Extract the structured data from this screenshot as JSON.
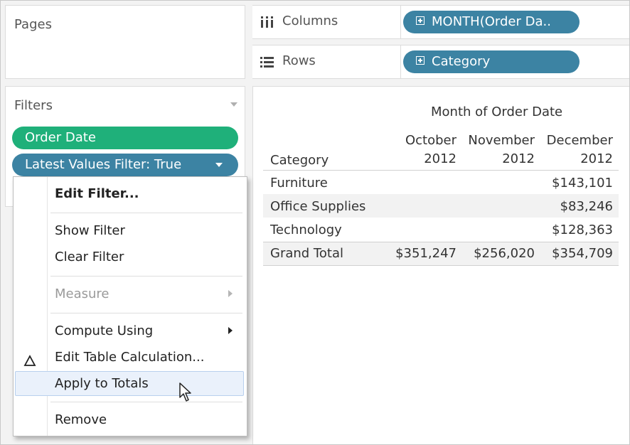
{
  "pages_card": {
    "title": "Pages"
  },
  "filters_card": {
    "title": "Filters",
    "pills": [
      {
        "label": "Order Date",
        "color": "#1fb07a"
      },
      {
        "label": "Latest Values Filter: True",
        "color": "#3c83a3"
      }
    ]
  },
  "shelves": {
    "columns": {
      "label": "Columns",
      "icon": "columns-icon",
      "pill": "MONTH(Order Da..",
      "pill_color": "#3c83a3"
    },
    "rows": {
      "label": "Rows",
      "icon": "rows-icon",
      "pill": "Category",
      "pill_color": "#3c83a3"
    }
  },
  "view": {
    "header_title": "Month of Order Date",
    "row_header": "Category",
    "columns": [
      {
        "month": "October",
        "year": "2012"
      },
      {
        "month": "November",
        "year": "2012"
      },
      {
        "month": "December",
        "year": "2012"
      }
    ],
    "rows": [
      {
        "category": "Furniture",
        "values": [
          "",
          "",
          "$143,101"
        ]
      },
      {
        "category": "Office Supplies",
        "values": [
          "",
          "",
          "$83,246"
        ]
      },
      {
        "category": "Technology",
        "values": [
          "",
          "",
          "$128,363"
        ]
      },
      {
        "category": "Grand Total",
        "values": [
          "$351,247",
          "$256,020",
          "$354,709"
        ]
      }
    ]
  },
  "context_menu": {
    "items": [
      {
        "label": "Edit Filter...",
        "bold": true
      },
      {
        "label": "Show Filter"
      },
      {
        "label": "Clear Filter"
      },
      {
        "label": "Measure",
        "disabled": true,
        "submenu": true
      },
      {
        "label": "Compute Using",
        "submenu": true
      },
      {
        "label": "Edit Table Calculation...",
        "icon": "delta-icon"
      },
      {
        "label": "Apply to Totals",
        "hovered": true
      },
      {
        "label": "Remove"
      }
    ],
    "hover_color": "#eaf1fb"
  },
  "cursor": {
    "icon": "mouse-pointer-icon"
  }
}
